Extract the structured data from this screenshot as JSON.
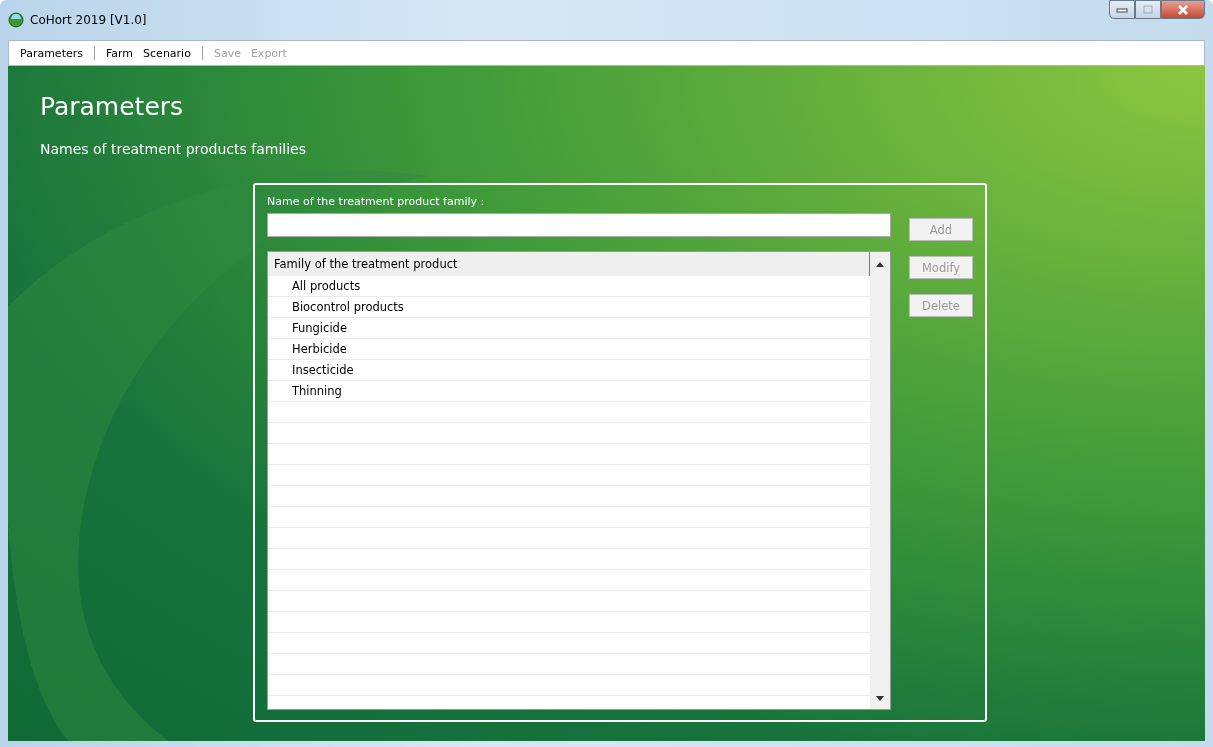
{
  "window": {
    "title": "CoHort 2019 [V1.0]"
  },
  "menu": [
    {
      "label": "Parameters",
      "disabled": false,
      "separator_after": true
    },
    {
      "label": "Farm",
      "disabled": false,
      "separator_after": false
    },
    {
      "label": "Scenario",
      "disabled": false,
      "separator_after": true
    },
    {
      "label": "Save",
      "disabled": true,
      "separator_after": false
    },
    {
      "label": "Export",
      "disabled": true,
      "separator_after": false
    }
  ],
  "page": {
    "title": "Parameters",
    "subtitle": "Names of treatment products families"
  },
  "form": {
    "label": "Name of the treatment product family :"
  },
  "buttons": [
    {
      "label": "Add",
      "disabled": true
    },
    {
      "label": "Modify",
      "disabled": true
    },
    {
      "label": "Delete",
      "disabled": true
    }
  ],
  "list": {
    "column": "Family of the treatment product",
    "rows": [
      {
        "label": "All products",
        "selected": false
      },
      {
        "label": "Biocontrol products",
        "selected": false
      },
      {
        "label": "Fungicide",
        "selected": false
      },
      {
        "label": "Herbicide",
        "selected": false
      },
      {
        "label": "Insecticide",
        "selected": false
      },
      {
        "label": "Thinning",
        "selected": false
      }
    ]
  }
}
